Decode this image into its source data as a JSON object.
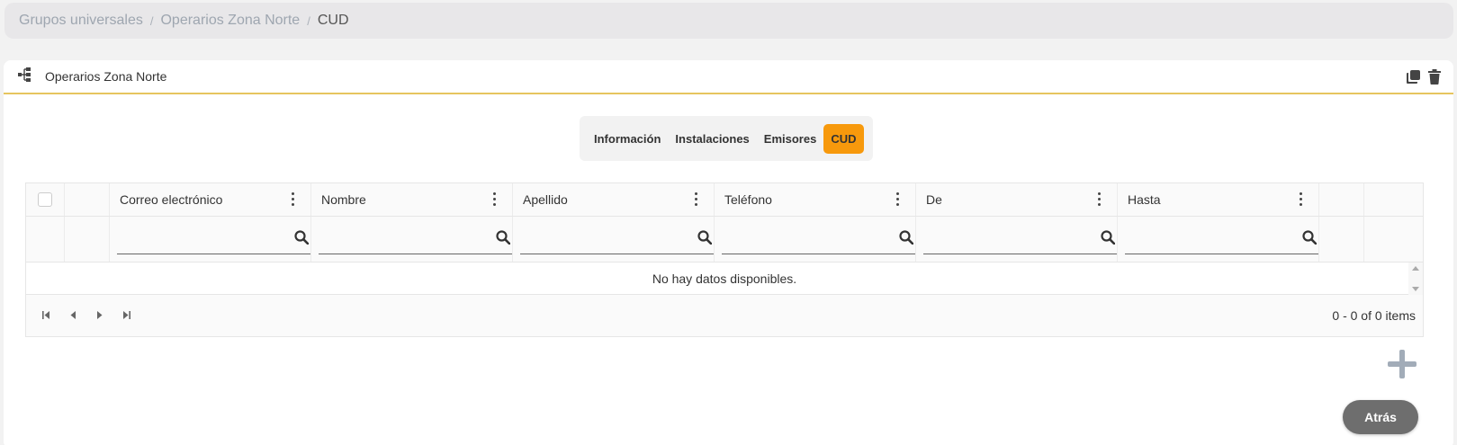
{
  "breadcrumb": {
    "items": [
      "Grupos universales",
      "Operarios Zona Norte"
    ],
    "separator": "/",
    "current": "CUD"
  },
  "card": {
    "title": "Operarios Zona Norte",
    "icon": "tree-structure-icon",
    "actions": [
      "copy-icon",
      "trash-icon"
    ]
  },
  "tabs": [
    {
      "label": "Información",
      "active": false
    },
    {
      "label": "Instalaciones",
      "active": false
    },
    {
      "label": "Emisores",
      "active": false
    },
    {
      "label": "CUD",
      "active": true
    }
  ],
  "grid": {
    "columns": [
      "Correo electrónico",
      "Nombre",
      "Apellido",
      "Teléfono",
      "De",
      "Hasta"
    ],
    "no_data": "No hay datos disponibles.",
    "pager_info": "0 - 0 of 0 items"
  },
  "buttons": {
    "back": "Atrás"
  },
  "colors": {
    "accent_tab": "#f7990c",
    "header_border": "#e6c55e",
    "back_button": "#6e6e6e",
    "add_icon": "#a2acb8"
  }
}
